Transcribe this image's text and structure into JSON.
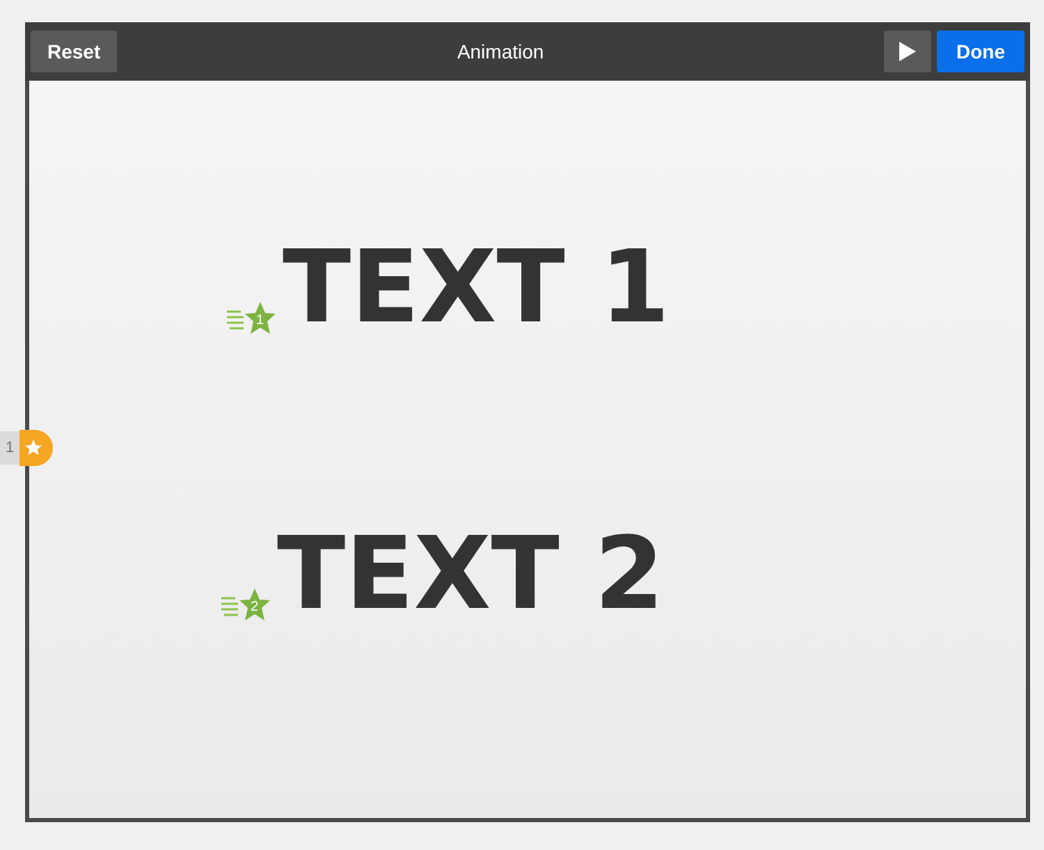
{
  "toolbar": {
    "reset": "Reset",
    "title": "Animation",
    "done": "Done"
  },
  "side_marker": {
    "label": "1"
  },
  "texts": [
    {
      "text": "TEXT 1",
      "order": "1"
    },
    {
      "text": "TEXT 2",
      "order": "2"
    }
  ]
}
